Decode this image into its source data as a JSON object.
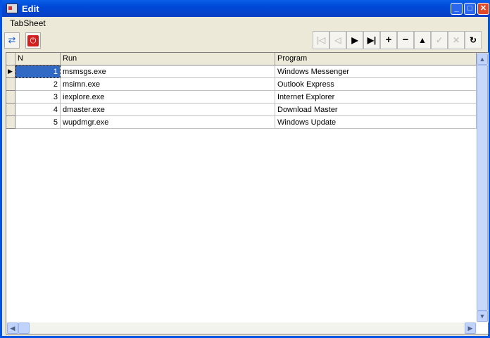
{
  "window": {
    "title": "Edit"
  },
  "menu": {
    "tabsheet": "TabSheet"
  },
  "toolbar": {
    "refresh_icon": "refresh-icon",
    "power_icon": "power-icon"
  },
  "navigator": [
    "first",
    "prior",
    "next",
    "last",
    "insert",
    "delete",
    "edit",
    "post",
    "cancel",
    "refresh"
  ],
  "grid": {
    "columns": [
      "N",
      "Run",
      "Program"
    ],
    "rows": [
      {
        "n": "1",
        "run": "msmsgs.exe",
        "program": "Windows Messenger"
      },
      {
        "n": "2",
        "run": "msimn.exe",
        "program": "Outlook Express"
      },
      {
        "n": "3",
        "run": "iexplore.exe",
        "program": "Internet Explorer"
      },
      {
        "n": "4",
        "run": "dmaster.exe",
        "program": "Download Master"
      },
      {
        "n": "5",
        "run": "wupdmgr.exe",
        "program": "Windows Update"
      }
    ]
  }
}
